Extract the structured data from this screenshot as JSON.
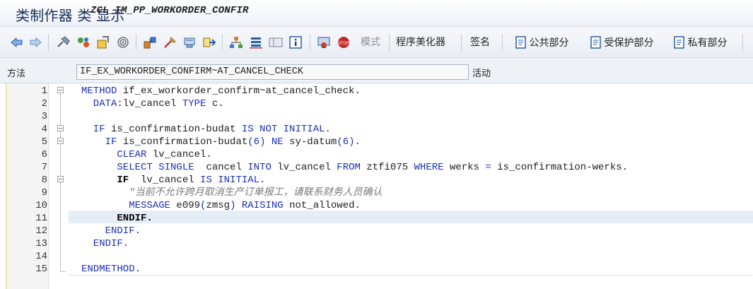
{
  "window": {
    "title_prefix": "类制作器 类 ",
    "title_code": "ZCL_IM_PP_WORKORDER_CONFIR",
    "title_suffix": " 显示"
  },
  "toolbar": {
    "buttons": [
      {
        "name": "back-icon"
      },
      {
        "name": "forward-icon"
      },
      {
        "name": "other-object-icon"
      },
      {
        "name": "display-change-icon"
      },
      {
        "name": "active-inactive-icon"
      },
      {
        "name": "check-icon"
      },
      {
        "name": "activate-icon"
      },
      {
        "name": "test-icon"
      },
      {
        "name": "where-used-icon"
      },
      {
        "name": "navigate-icon"
      },
      {
        "name": "hierarchy-icon"
      },
      {
        "name": "object-list-icon"
      },
      {
        "name": "layout-icon"
      },
      {
        "name": "info-icon"
      },
      {
        "name": "signature-icon"
      },
      {
        "name": "stop-icon"
      }
    ],
    "mode_label": "模式",
    "pretty_printer_label": "程序美化器",
    "signature_label": "签名",
    "public_label": "公共部分",
    "protected_label": "受保护部分",
    "private_label": "私有部分",
    "accent": "#1a2fb8"
  },
  "method_row": {
    "label": "方法",
    "value": "IF_EX_WORKORDER_CONFIRM~AT_CANCEL_CHECK",
    "status": "活动"
  },
  "editor": {
    "lines": [
      {
        "num": "1",
        "parts": [
          {
            "t": "METHOD",
            "c": "kw"
          },
          {
            "t": " if_ex_workorder_confirm~at_cancel_check.",
            "c": ""
          }
        ]
      },
      {
        "num": "2",
        "parts": [
          {
            "t": "  DATA",
            "c": "kw"
          },
          {
            "t": ":lv_cancel ",
            "c": ""
          },
          {
            "t": "TYPE",
            "c": "kw"
          },
          {
            "t": " c.",
            "c": ""
          }
        ]
      },
      {
        "num": "3",
        "parts": []
      },
      {
        "num": "4",
        "parts": [
          {
            "t": "  IF",
            "c": "kw"
          },
          {
            "t": " is_confirmation-budat ",
            "c": ""
          },
          {
            "t": "IS NOT INITIAL.",
            "c": "kw"
          }
        ]
      },
      {
        "num": "5",
        "parts": [
          {
            "t": "    IF",
            "c": "kw"
          },
          {
            "t": " is_confirmation-budat",
            "c": ""
          },
          {
            "t": "(6)",
            "c": "kw"
          },
          {
            "t": " ",
            "c": ""
          },
          {
            "t": "NE",
            "c": "kw"
          },
          {
            "t": " sy-datum",
            "c": ""
          },
          {
            "t": "(6).",
            "c": "kw"
          }
        ]
      },
      {
        "num": "6",
        "parts": [
          {
            "t": "      CLEAR",
            "c": "kw"
          },
          {
            "t": " lv_cancel.",
            "c": ""
          }
        ]
      },
      {
        "num": "7",
        "parts": [
          {
            "t": "      SELECT SINGLE",
            "c": "kw"
          },
          {
            "t": "  cancel ",
            "c": ""
          },
          {
            "t": "INTO",
            "c": "kw"
          },
          {
            "t": " lv_cancel ",
            "c": ""
          },
          {
            "t": "FROM",
            "c": "kw"
          },
          {
            "t": " ztfi075 ",
            "c": ""
          },
          {
            "t": "WHERE",
            "c": "kw"
          },
          {
            "t": " werks ",
            "c": ""
          },
          {
            "t": "=",
            "c": "kw"
          },
          {
            "t": " is_confirmation-werks.",
            "c": ""
          }
        ]
      },
      {
        "num": "8",
        "parts": [
          {
            "t": "      IF",
            "c": "bk"
          },
          {
            "t": "  lv_cancel ",
            "c": ""
          },
          {
            "t": "IS INITIAL.",
            "c": "kw"
          }
        ]
      },
      {
        "num": "9",
        "parts": [
          {
            "t": "        \"当前不允许跨月取消生产订单报工，请联系财务人员确认",
            "c": "cm"
          }
        ]
      },
      {
        "num": "10",
        "parts": [
          {
            "t": "        MESSAGE",
            "c": "kw"
          },
          {
            "t": " e099",
            "c": ""
          },
          {
            "t": "(",
            "c": "kw"
          },
          {
            "t": "zmsg",
            "c": ""
          },
          {
            "t": ")",
            "c": "kw"
          },
          {
            "t": " ",
            "c": ""
          },
          {
            "t": "RAISING",
            "c": "kw"
          },
          {
            "t": " not_allowed.",
            "c": ""
          }
        ]
      },
      {
        "num": "11",
        "parts": [
          {
            "t": "      ENDIF.",
            "c": "bk"
          }
        ]
      },
      {
        "num": "12",
        "parts": [
          {
            "t": "    ENDIF.",
            "c": "kw"
          }
        ]
      },
      {
        "num": "13",
        "parts": [
          {
            "t": "  ENDIF.",
            "c": "kw"
          }
        ]
      },
      {
        "num": "14",
        "parts": []
      },
      {
        "num": "15",
        "parts": [
          {
            "t": "ENDMETHOD.",
            "c": "kw"
          }
        ]
      }
    ]
  }
}
